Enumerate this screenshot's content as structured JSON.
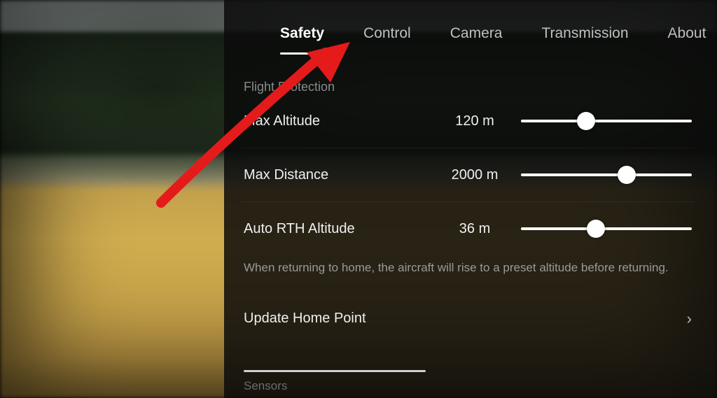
{
  "tabs": {
    "safety": "Safety",
    "control": "Control",
    "camera": "Camera",
    "transmission": "Transmission",
    "about": "About",
    "active": "safety"
  },
  "section": {
    "flight_protection": "Flight Protection"
  },
  "settings": {
    "max_altitude": {
      "label": "Max Altitude",
      "value": "120 m",
      "pct": 38
    },
    "max_distance": {
      "label": "Max Distance",
      "value": "2000 m",
      "pct": 62
    },
    "auto_rth": {
      "label": "Auto RTH Altitude",
      "value": "36 m",
      "pct": 44
    }
  },
  "help": {
    "auto_rth": "When returning to home, the aircraft will rise to a preset altitude before returning."
  },
  "rows": {
    "update_home_point": "Update Home Point"
  },
  "cutoff_label": "Sensors",
  "annotation": {
    "type": "arrow",
    "color": "#e51b1b",
    "points_to": "tab-control"
  }
}
